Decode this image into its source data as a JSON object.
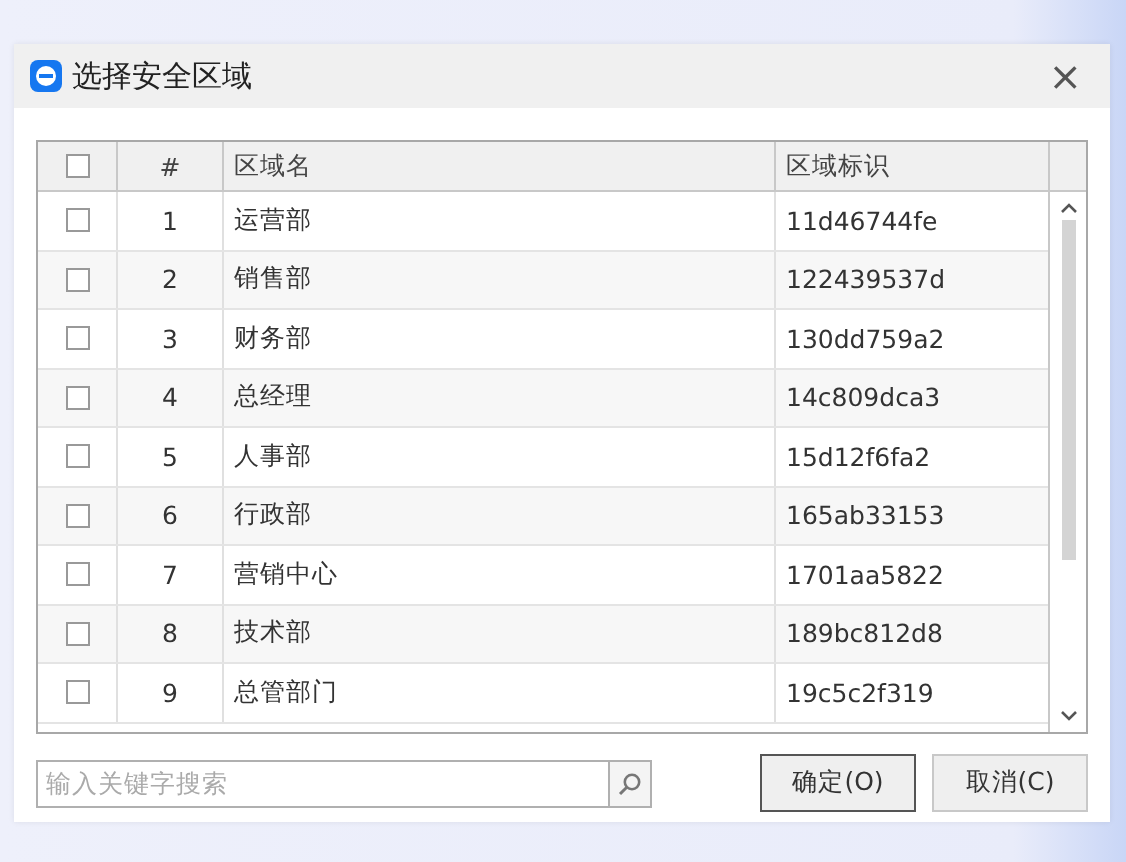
{
  "window": {
    "title": "选择安全区域",
    "close": "×"
  },
  "table": {
    "select_all": {
      "checked": false
    },
    "columns": [
      "#",
      "区域名",
      "区域标识"
    ],
    "rows": [
      {
        "checked": false,
        "index": "1",
        "name": "运营部",
        "id": "11d46744fe"
      },
      {
        "checked": false,
        "index": "2",
        "name": "销售部",
        "id": "122439537d"
      },
      {
        "checked": false,
        "index": "3",
        "name": "财务部",
        "id": "130dd759a2"
      },
      {
        "checked": false,
        "index": "4",
        "name": "总经理",
        "id": "14c809dca3"
      },
      {
        "checked": false,
        "index": "5",
        "name": "人事部",
        "id": "15d12f6fa2"
      },
      {
        "checked": false,
        "index": "6",
        "name": "行政部",
        "id": "165ab33153"
      },
      {
        "checked": false,
        "index": "7",
        "name": "营销中心",
        "id": "1701aa5822"
      },
      {
        "checked": false,
        "index": "8",
        "name": "技术部",
        "id": "189bc812d8"
      },
      {
        "checked": false,
        "index": "9",
        "name": "总管部门",
        "id": "19c5c2f319"
      }
    ]
  },
  "search": {
    "placeholder": "输入关键字搜索"
  },
  "buttons": [
    {
      "label": "确定(O)",
      "default": true
    },
    {
      "label": "取消(C)",
      "default": false
    }
  ]
}
